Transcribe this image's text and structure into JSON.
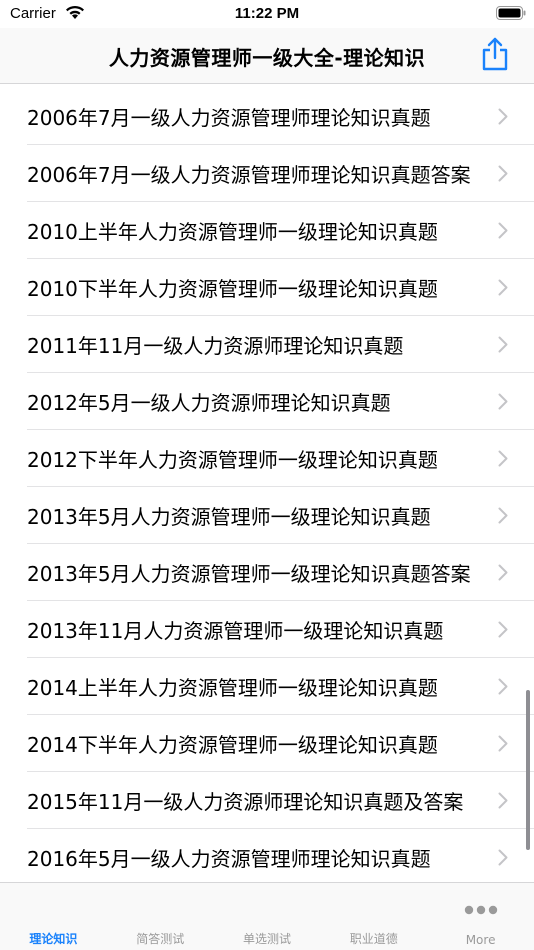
{
  "status": {
    "carrier": "Carrier",
    "time": "11:22 PM"
  },
  "nav": {
    "title": "人力资源管理师一级大全-理论知识"
  },
  "list": {
    "items": [
      "2006年7月一级人力资源管理师理论知识真题",
      "2006年7月一级人力资源管理师理论知识真题答案",
      "2010上半年人力资源管理师一级理论知识真题",
      "2010下半年人力资源管理师一级理论知识真题",
      "2011年11月一级人力资源师理论知识真题",
      "2012年5月一级人力资源师理论知识真题",
      "2012下半年人力资源管理师一级理论知识真题",
      "2013年5月人力资源管理师一级理论知识真题",
      "2013年5月人力资源管理师一级理论知识真题答案",
      "2013年11月人力资源管理师一级理论知识真题",
      "2014上半年人力资源管理师一级理论知识真题",
      "2014下半年人力资源管理师一级理论知识真题",
      "2015年11月一级人力资源师理论知识真题及答案",
      "2016年5月一级人力资源管理师理论知识真题"
    ]
  },
  "tabs": {
    "items": [
      "理论知识",
      "简答测试",
      "单选测试",
      "职业道德",
      "More"
    ],
    "active_index": 0
  },
  "colors": {
    "accent": "#1a82fb",
    "inactive": "#9a9a9a",
    "separator": "#e3e3e5"
  },
  "icons": {
    "wifi": "wifi-icon",
    "battery": "battery-icon",
    "share": "share-icon",
    "chevron": "chevron-right-icon",
    "more": "more-dots-icon"
  }
}
